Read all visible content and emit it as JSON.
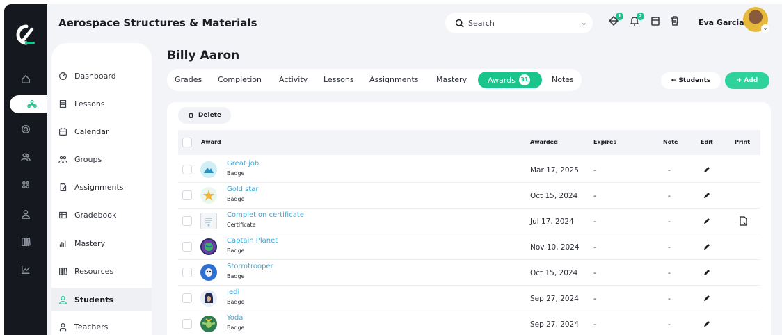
{
  "app": {
    "title": "Aerospace Structures & Materials"
  },
  "search": {
    "placeholder": "Search"
  },
  "notifications": {
    "messages_count": "1",
    "alerts_count": "2"
  },
  "user": {
    "name": "Eva Garcia"
  },
  "colors": {
    "accent": "#19c58b",
    "link": "#3aa8d8",
    "rail": "#16181f"
  },
  "rail_icons": [
    "home-icon",
    "students-icon",
    "target-icon",
    "users-icon",
    "groups-icon",
    "person-icon",
    "library-icon",
    "chart-icon"
  ],
  "nav": {
    "items": [
      {
        "label": "Dashboard",
        "icon": "dashboard-icon"
      },
      {
        "label": "Lessons",
        "icon": "lessons-icon"
      },
      {
        "label": "Calendar",
        "icon": "calendar-icon"
      },
      {
        "label": "Groups",
        "icon": "groups-icon"
      },
      {
        "label": "Assignments",
        "icon": "assignments-icon"
      },
      {
        "label": "Gradebook",
        "icon": "gradebook-icon"
      },
      {
        "label": "Mastery",
        "icon": "mastery-icon"
      },
      {
        "label": "Resources",
        "icon": "resources-icon"
      },
      {
        "label": "Students",
        "icon": "student-icon",
        "active": true
      },
      {
        "label": "Teachers",
        "icon": "teacher-icon"
      }
    ]
  },
  "student": {
    "name": "Billy Aaron"
  },
  "tabs": [
    {
      "label": "Grades"
    },
    {
      "label": "Completion"
    },
    {
      "label": "Activity"
    },
    {
      "label": "Lessons"
    },
    {
      "label": "Assignments"
    },
    {
      "label": "Mastery"
    },
    {
      "label": "Awards",
      "count": "31",
      "active": true
    },
    {
      "label": "Notes"
    }
  ],
  "actions": {
    "back_label": "← Students",
    "add_label": "+ Add",
    "delete_label": "Delete"
  },
  "table": {
    "headers": {
      "award": "Award",
      "awarded": "Awarded",
      "expires": "Expires",
      "note": "Note",
      "edit": "Edit",
      "print": "Print"
    },
    "rows": [
      {
        "name": "Great job",
        "type": "Badge",
        "awarded": "Mar 17, 2025",
        "expires": "-",
        "note": "-",
        "icon": "mountain-badge-icon",
        "printable": false
      },
      {
        "name": "Gold star",
        "type": "Badge",
        "awarded": "Oct 15, 2024",
        "expires": "-",
        "note": "-",
        "icon": "star-badge-icon",
        "printable": false
      },
      {
        "name": "Completion certificate",
        "type": "Certificate",
        "awarded": "Jul 17, 2024",
        "expires": "-",
        "note": "-",
        "icon": "certificate-icon",
        "printable": true
      },
      {
        "name": "Captain Planet",
        "type": "Badge",
        "awarded": "Nov 10, 2024",
        "expires": "-",
        "note": "-",
        "icon": "planet-badge-icon",
        "printable": false
      },
      {
        "name": "Stormtrooper",
        "type": "Badge",
        "awarded": "Oct 15, 2024",
        "expires": "-",
        "note": "-",
        "icon": "stormtrooper-badge-icon",
        "printable": false
      },
      {
        "name": "Jedi",
        "type": "Badge",
        "awarded": "Sep 27, 2024",
        "expires": "-",
        "note": "-",
        "icon": "jedi-badge-icon",
        "printable": false
      },
      {
        "name": "Yoda",
        "type": "Badge",
        "awarded": "Sep 27, 2024",
        "expires": "-",
        "note": "-",
        "icon": "yoda-badge-icon",
        "printable": false
      }
    ]
  }
}
